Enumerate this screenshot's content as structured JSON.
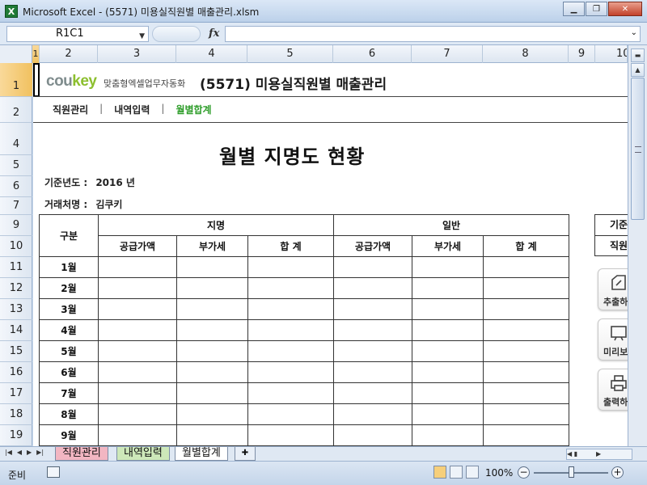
{
  "window": {
    "icon_letter": "X",
    "title": "Microsoft Excel - (5571) 미용실직원별 매출관리.xlsm",
    "min_glyph": "▁",
    "max_glyph": "❐",
    "close_glyph": "✕"
  },
  "formula_bar": {
    "name_box": "R1C1",
    "fx_label": "fx",
    "formula": ""
  },
  "columns": [
    "1",
    "2",
    "3",
    "4",
    "5",
    "6",
    "7",
    "8",
    "9",
    "10"
  ],
  "rows": [
    "1",
    "2",
    "4",
    "5",
    "6",
    "7",
    "9",
    "10",
    "11",
    "12",
    "13",
    "14",
    "15",
    "16",
    "17",
    "18",
    "19"
  ],
  "header": {
    "brand_co": "cou",
    "brand_key": "key",
    "brand_tagline": "맞춤형엑셀업무자동화",
    "doc_title": "(5571) 미용실직원별 매출관리"
  },
  "nav": {
    "items": [
      {
        "label": "직원관리",
        "active": false
      },
      {
        "label": "내역입력",
        "active": false
      },
      {
        "label": "월별합계",
        "active": true
      }
    ],
    "separator": "|"
  },
  "report": {
    "title": "월별 지명도 현황",
    "year_label": "기준년도 :",
    "year_value": "2016 년",
    "client_label": "거래처명 :",
    "client_value": "김쿠키"
  },
  "table": {
    "corner": "구분",
    "group_1": "지명",
    "group_2": "일반",
    "sub_headers": [
      "공급가액",
      "부가세",
      "합 계",
      "공급가액",
      "부가세",
      "합 계"
    ],
    "months": [
      "1월",
      "2월",
      "3월",
      "4월",
      "5월",
      "6월",
      "7월",
      "8월",
      "9월"
    ]
  },
  "side_panel": {
    "top_box": "기준",
    "second_box": "직원",
    "buttons": [
      {
        "label": "추출하",
        "icon": "extract-icon"
      },
      {
        "label": "미리보",
        "icon": "preview-icon"
      },
      {
        "label": "출력하",
        "icon": "print-icon"
      }
    ]
  },
  "sheet_tabs": {
    "tabs": [
      "직원관리",
      "내역입력",
      "월별합계"
    ],
    "active": "월별합계"
  },
  "status": {
    "ready": "준비",
    "zoom": "100%",
    "zoom_minus": "−",
    "zoom_plus": "+"
  }
}
